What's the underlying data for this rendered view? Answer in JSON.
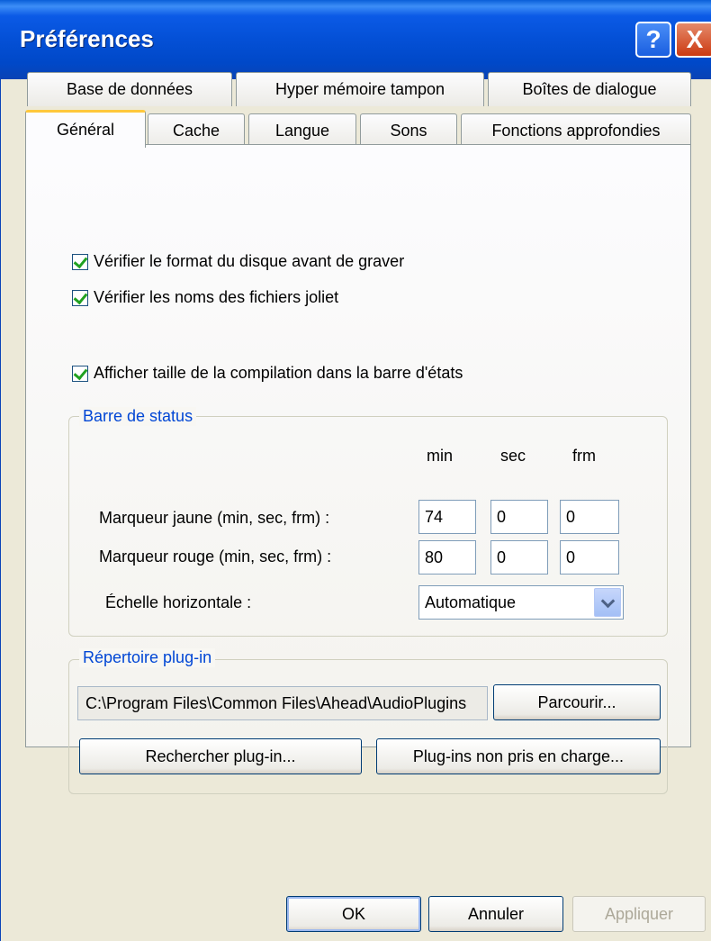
{
  "window": {
    "title": "Préférences",
    "help_label": "?",
    "close_label": "X"
  },
  "tabs_row1": [
    "Base de données",
    "Hyper mémoire tampon",
    "Boîtes de dialogue"
  ],
  "tabs_row2": [
    "Général",
    "Cache",
    "Langue",
    "Sons",
    "Fonctions approfondies"
  ],
  "active_tab": "Général",
  "options": {
    "check_format": {
      "label": "Vérifier le format du disque avant de graver",
      "checked": true
    },
    "check_joliet": {
      "label": "Vérifier les noms des fichiers joliet",
      "checked": true
    },
    "show_size": {
      "label": "Afficher taille de la compilation dans la barre d'états",
      "checked": true
    }
  },
  "status_bar": {
    "title": "Barre de status",
    "col_min": "min",
    "col_sec": "sec",
    "col_frm": "frm",
    "yellow_label": "Marqueur jaune (min, sec, frm) :",
    "yellow": {
      "min": "74",
      "sec": "0",
      "frm": "0"
    },
    "red_label": "Marqueur rouge (min, sec, frm) :",
    "red": {
      "min": "80",
      "sec": "0",
      "frm": "0"
    },
    "scale_label": "Échelle horizontale :",
    "scale_value": "Automatique"
  },
  "plugin": {
    "title": "Répertoire plug-in",
    "path": "C:\\Program Files\\Common Files\\Ahead\\AudioPlugins",
    "browse_label": "Parcourir...",
    "search_label": "Rechercher plug-in...",
    "unsupported_label": "Plug-ins non pris en charge..."
  },
  "footer": {
    "ok_label": "OK",
    "cancel_label": "Annuler",
    "apply_label": "Appliquer"
  }
}
